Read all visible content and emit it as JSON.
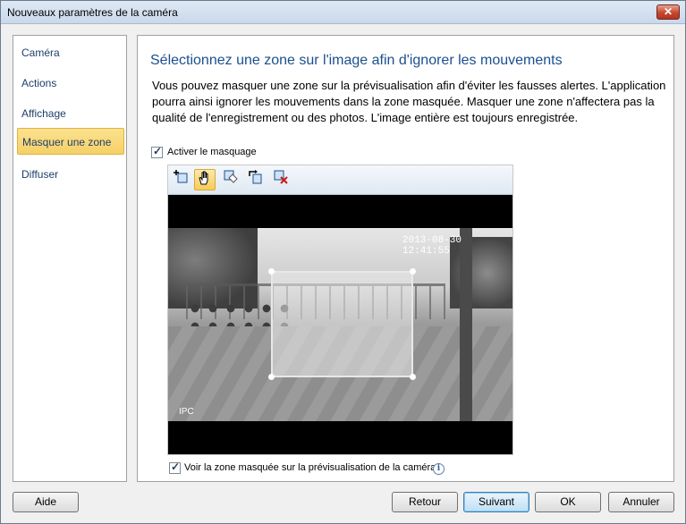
{
  "window": {
    "title": "Nouveaux paramètres de la caméra",
    "close_label": "✕"
  },
  "sidebar": {
    "items": [
      {
        "label": "Caméra",
        "active": false
      },
      {
        "label": "Actions",
        "active": false
      },
      {
        "label": "Affichage",
        "active": false
      },
      {
        "label": "Masquer une zone",
        "active": true
      },
      {
        "label": "Diffuser",
        "active": false
      }
    ]
  },
  "main": {
    "heading": "Sélectionnez une zone sur l'image afin d'ignorer les mouvements",
    "description": "Vous pouvez masquer une zone sur la prévisualisation afin d'éviter les fausses alertes. L'application pourra ainsi ignorer les mouvements dans la zone masquée. Masquer une zone n'affectera pas la qualité de l'enregistrement ou des photos. L'image entière est toujours enregistrée.",
    "enable_masking": {
      "label": "Activer le masquage",
      "checked": true
    },
    "toolbar": {
      "tools": [
        {
          "icon": "add-zone-icon",
          "active": false
        },
        {
          "icon": "hand-icon",
          "active": true
        },
        {
          "icon": "eraser-icon",
          "active": false
        },
        {
          "icon": "rotate-icon",
          "active": false
        },
        {
          "icon": "clear-zone-icon",
          "active": false
        }
      ]
    },
    "video": {
      "timestamp": "2013-08-30 12:41:55",
      "channel": "IPC"
    },
    "show_mask_preview": {
      "label": "Voir la zone masquée sur la prévisualisation de la caméra",
      "checked": true
    }
  },
  "footer": {
    "help_label": "Aide",
    "back_label": "Retour",
    "next_label": "Suivant",
    "ok_label": "OK",
    "cancel_label": "Annuler"
  },
  "colors": {
    "accent": "#1b4f8f",
    "selected": "#f6d067",
    "title_bar": "#c9d8ea"
  }
}
